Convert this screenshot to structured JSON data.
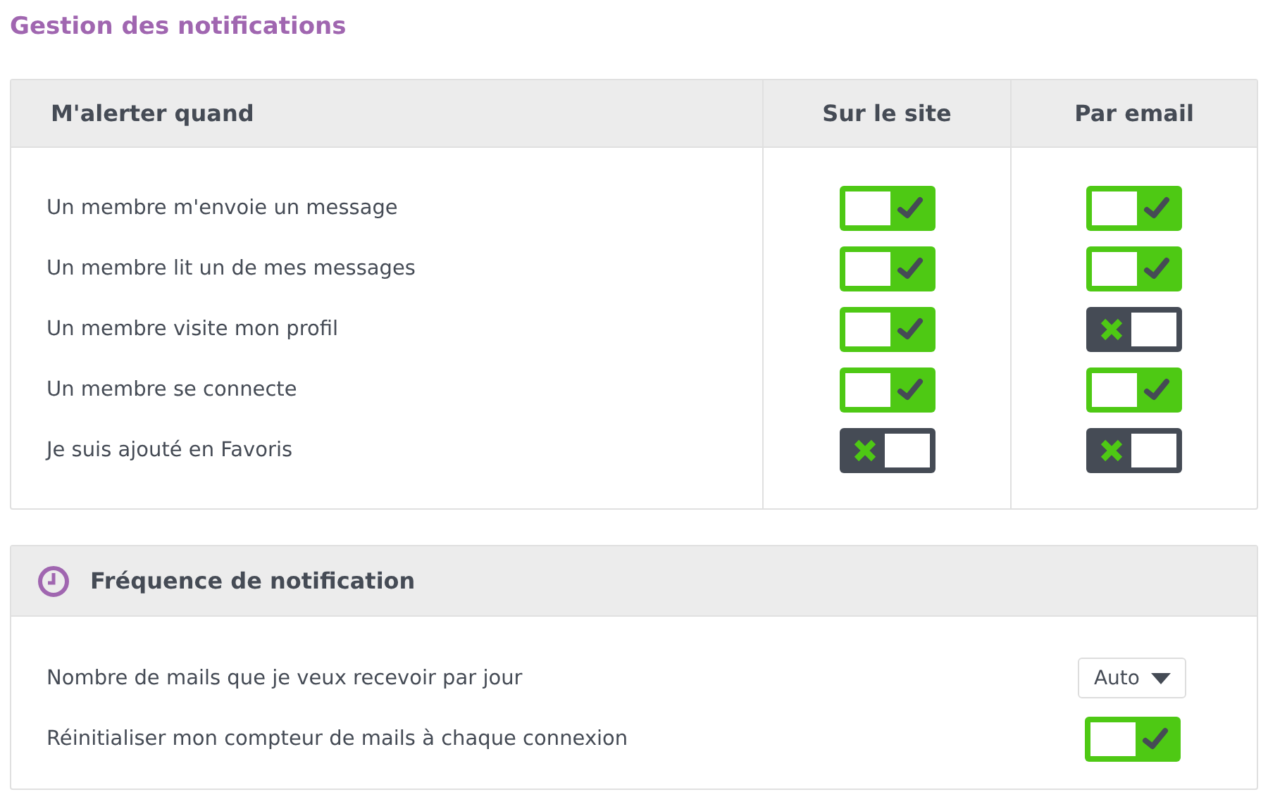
{
  "title": "Gestion des notifications",
  "alerts": {
    "columns": [
      "M'alerter quand",
      "Sur le site",
      "Par email"
    ],
    "rows": [
      {
        "label": "Un membre m'envoie un message",
        "site": true,
        "email": true
      },
      {
        "label": "Un membre lit un de mes messages",
        "site": true,
        "email": true
      },
      {
        "label": "Un membre visite mon profil",
        "site": true,
        "email": false
      },
      {
        "label": "Un membre se connecte",
        "site": true,
        "email": true
      },
      {
        "label": "Je suis ajouté en Favoris",
        "site": false,
        "email": false
      }
    ]
  },
  "frequency": {
    "title": "Fréquence de notification",
    "rows": [
      {
        "kind": "select",
        "label": "Nombre de mails que je veux recevoir par jour",
        "value": "Auto"
      },
      {
        "kind": "toggle",
        "label": "Réinitialiser mon compteur de mails à chaque connexion",
        "on": true
      }
    ]
  }
}
